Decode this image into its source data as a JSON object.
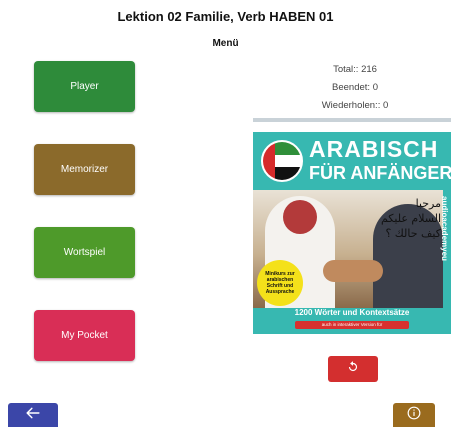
{
  "header": {
    "title": "Lektion 02 Familie, Verb HABEN 01",
    "subtitle": "Menü"
  },
  "menu": {
    "player": {
      "label": "Player",
      "color": "#2e8b3a"
    },
    "memorizer": {
      "label": "Memorizer",
      "color": "#8b6a2b"
    },
    "wortspiel": {
      "label": "Wortspiel",
      "color": "#4e9a2a"
    },
    "mypocket": {
      "label": "My Pocket",
      "color": "#d92e56"
    }
  },
  "stats": {
    "total": "Total:: 216",
    "done": "Beendet: 0",
    "repeat": "Wiederholen:: 0",
    "progress_fraction": 0
  },
  "cover": {
    "title_line1": "ARABISCH",
    "title_line2": "FÜR ANFÄNGER",
    "arabic_line1": "مرحبا",
    "arabic_line2": "السلام عليكم",
    "arabic_line3": "كيف حالك ؟",
    "side_brand": "audioacademyeu",
    "badge_text": "Minikurs zur arabischen Schrift und Aussprache",
    "bottom_text": "1200 Wörter und Kontextsätze",
    "strip_text": "auch in interaktiver Version für"
  },
  "icons": {
    "refresh": "refresh-icon",
    "back": "arrow-left-icon",
    "info": "info-icon"
  },
  "colors": {
    "refresh": "#d32f2f",
    "back": "#3b46a8",
    "info": "#9a6b1e"
  }
}
